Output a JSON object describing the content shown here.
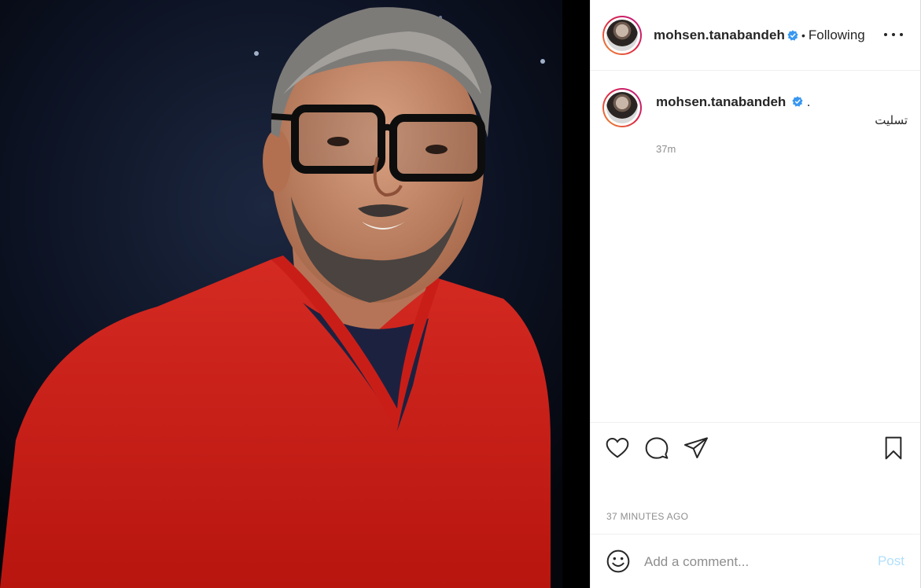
{
  "header": {
    "username": "mohsen.tanabandeh",
    "separator": "•",
    "follow_status": "Following"
  },
  "caption": {
    "username": "mohsen.tanabandeh",
    "trailing": ".",
    "text": "تسلیت",
    "age": "37m"
  },
  "actions": {
    "like_icon": "heart-icon",
    "comment_icon": "comment-icon",
    "share_icon": "paper-plane-icon",
    "save_icon": "bookmark-icon"
  },
  "timestamp": "37 MINUTES AGO",
  "comment_box": {
    "placeholder": "Add a comment...",
    "post_label": "Post",
    "emoji_icon": "smiley-icon"
  },
  "colors": {
    "verified": "#3897f0",
    "post_disabled": "#b2dffc",
    "muted": "#8e8e8e"
  }
}
